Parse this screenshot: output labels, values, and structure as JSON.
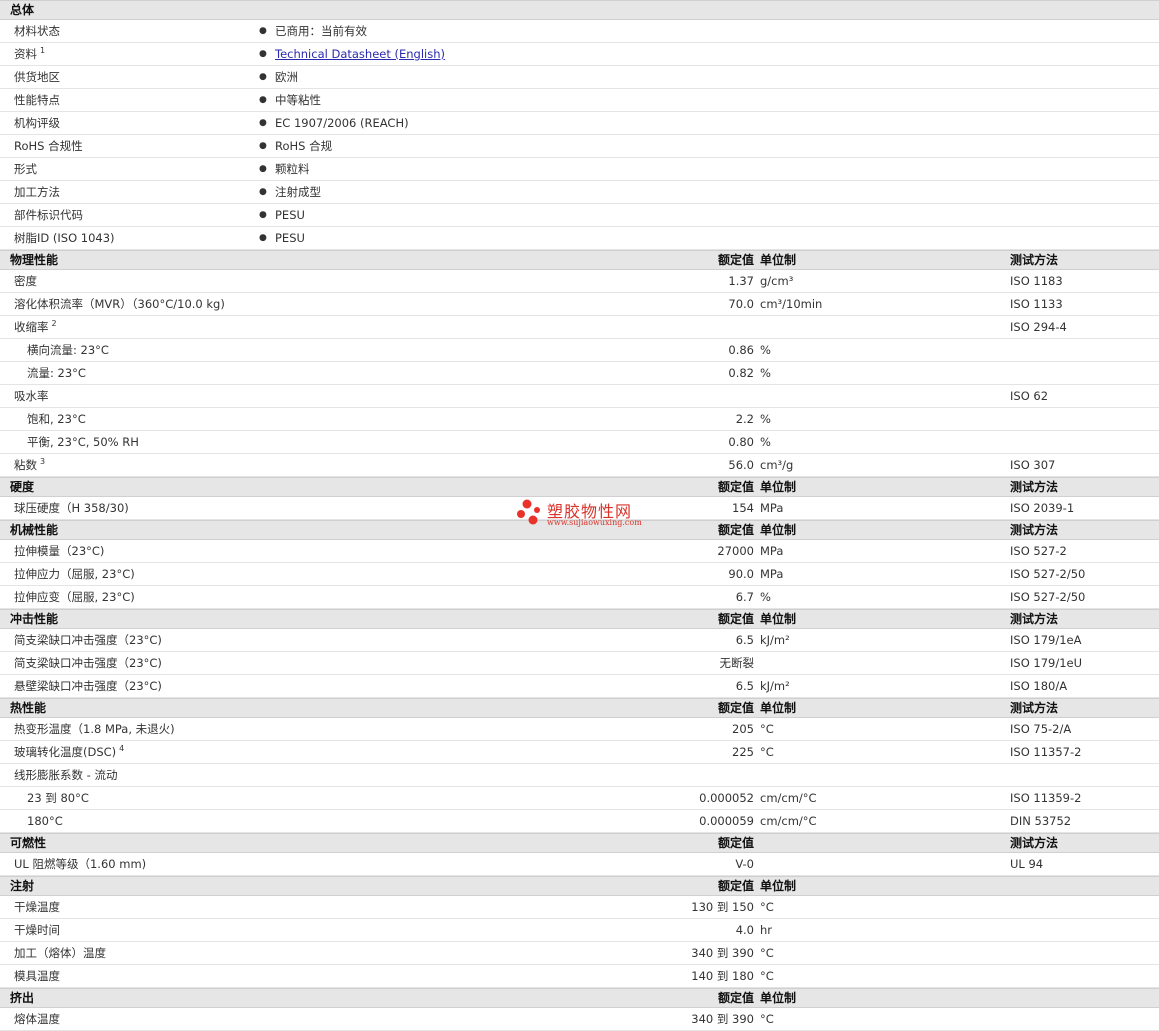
{
  "rows": [
    {
      "type": "section",
      "label": "总体"
    },
    {
      "type": "item",
      "label": "材料状态",
      "value": "已商用：当前有效"
    },
    {
      "type": "item",
      "label": "资料",
      "sup": "1",
      "value": "Technical Datasheet (English)",
      "link": true
    },
    {
      "type": "item",
      "label": "供货地区",
      "value": "欧洲"
    },
    {
      "type": "item",
      "label": "性能特点",
      "value": "中等粘性"
    },
    {
      "type": "item",
      "label": "机构评级",
      "value": "EC 1907/2006 (REACH)"
    },
    {
      "type": "item",
      "label": "RoHS 合规性",
      "value": "RoHS 合规"
    },
    {
      "type": "item",
      "label": "形式",
      "value": "颗粒料"
    },
    {
      "type": "item",
      "label": "加工方法",
      "value": "注射成型"
    },
    {
      "type": "item",
      "label": "部件标识代码",
      "value": "PESU"
    },
    {
      "type": "item",
      "label": "树脂ID (ISO 1043)",
      "value": "PESU"
    },
    {
      "type": "section",
      "label": "物理性能",
      "nominal": "额定值",
      "unit": "单位制",
      "method": "测试方法"
    },
    {
      "type": "prop",
      "label": "密度",
      "nominal": "1.37",
      "unit": "g/cm³",
      "method": "ISO 1183"
    },
    {
      "type": "prop",
      "label": "溶化体积流率（MVR）（360°C/10.0 kg)",
      "nominal": "70.0",
      "unit": "cm³/10min",
      "method": "ISO 1133"
    },
    {
      "type": "prop",
      "label": "收缩率",
      "sup": "2",
      "method": "ISO 294-4"
    },
    {
      "type": "prop",
      "sub": true,
      "label": "横向流量: 23°C",
      "nominal": "0.86",
      "unit": "%"
    },
    {
      "type": "prop",
      "sub": true,
      "label": "流量: 23°C",
      "nominal": "0.82",
      "unit": "%"
    },
    {
      "type": "prop",
      "label": "吸水率",
      "method": "ISO 62"
    },
    {
      "type": "prop",
      "sub": true,
      "label": "饱和, 23°C",
      "nominal": "2.2",
      "unit": "%"
    },
    {
      "type": "prop",
      "sub": true,
      "label": "平衡, 23°C, 50% RH",
      "nominal": "0.80",
      "unit": "%"
    },
    {
      "type": "prop",
      "label": "粘数",
      "sup": "3",
      "nominal": "56.0",
      "unit": "cm³/g",
      "method": "ISO 307"
    },
    {
      "type": "section",
      "label": "硬度",
      "nominal": "额定值",
      "unit": "单位制",
      "method": "测试方法"
    },
    {
      "type": "prop",
      "label": "球压硬度（H 358/30)",
      "nominal": "154",
      "unit": "MPa",
      "method": "ISO 2039-1"
    },
    {
      "type": "section",
      "label": "机械性能",
      "nominal": "额定值",
      "unit": "单位制",
      "method": "测试方法"
    },
    {
      "type": "prop",
      "label": "拉伸模量（23°C)",
      "nominal": "27000",
      "unit": "MPa",
      "method": "ISO 527-2"
    },
    {
      "type": "prop",
      "label": "拉伸应力（屈服, 23°C)",
      "nominal": "90.0",
      "unit": "MPa",
      "method": "ISO 527-2/50"
    },
    {
      "type": "prop",
      "label": "拉伸应变（屈服, 23°C)",
      "nominal": "6.7",
      "unit": "%",
      "method": "ISO 527-2/50"
    },
    {
      "type": "section",
      "label": "冲击性能",
      "nominal": "额定值",
      "unit": "单位制",
      "method": "测试方法"
    },
    {
      "type": "prop",
      "label": "简支梁缺口冲击强度（23°C)",
      "nominal": "6.5",
      "unit": "kJ/m²",
      "method": "ISO 179/1eA"
    },
    {
      "type": "prop",
      "label": "简支梁缺口冲击强度（23°C)",
      "nominal": "无断裂",
      "method": "ISO 179/1eU"
    },
    {
      "type": "prop",
      "label": "悬壁梁缺口冲击强度（23°C)",
      "nominal": "6.5",
      "unit": "kJ/m²",
      "method": "ISO 180/A"
    },
    {
      "type": "section",
      "label": "热性能",
      "nominal": "额定值",
      "unit": "单位制",
      "method": "测试方法"
    },
    {
      "type": "prop",
      "label": "热变形温度（1.8 MPa, 未退火)",
      "nominal": "205",
      "unit": "°C",
      "method": "ISO 75-2/A"
    },
    {
      "type": "prop",
      "label": "玻璃转化温度(DSC)",
      "sup": "4",
      "nominal": "225",
      "unit": "°C",
      "method": "ISO 11357-2"
    },
    {
      "type": "prop",
      "label": "线形膨胀系数 - 流动"
    },
    {
      "type": "prop",
      "sub": true,
      "label": "23 到  80°C",
      "nominal": "0.000052",
      "unit": "cm/cm/°C",
      "method": "ISO 11359-2"
    },
    {
      "type": "prop",
      "sub": true,
      "label": "180°C",
      "nominal": "0.000059",
      "unit": "cm/cm/°C",
      "method": "DIN 53752"
    },
    {
      "type": "section",
      "label": "可燃性",
      "nominal": "额定值",
      "method": "测试方法"
    },
    {
      "type": "prop",
      "label": "UL 阻燃等级（1.60 mm)",
      "nominal": "V-0",
      "method": "UL 94"
    },
    {
      "type": "section",
      "label": "注射",
      "nominal": "额定值",
      "unit": "单位制"
    },
    {
      "type": "prop",
      "label": "干燥温度",
      "nominal": "130 到  150",
      "unit": "°C"
    },
    {
      "type": "prop",
      "label": "干燥时间",
      "nominal": "4.0",
      "unit": "hr"
    },
    {
      "type": "prop",
      "label": "加工（熔体）温度",
      "nominal": "340 到  390",
      "unit": "°C"
    },
    {
      "type": "prop",
      "label": "模具温度",
      "nominal": "140 到  180",
      "unit": "°C"
    },
    {
      "type": "section",
      "label": "挤出",
      "nominal": "额定值",
      "unit": "单位制"
    },
    {
      "type": "prop",
      "label": "熔体温度",
      "nominal": "340 到  390",
      "unit": "°C"
    }
  ],
  "bullet": "●",
  "watermark": {
    "name": "塑胶物性网",
    "url": "www.sujiaowuxing.com",
    "color": "#d9332a"
  }
}
